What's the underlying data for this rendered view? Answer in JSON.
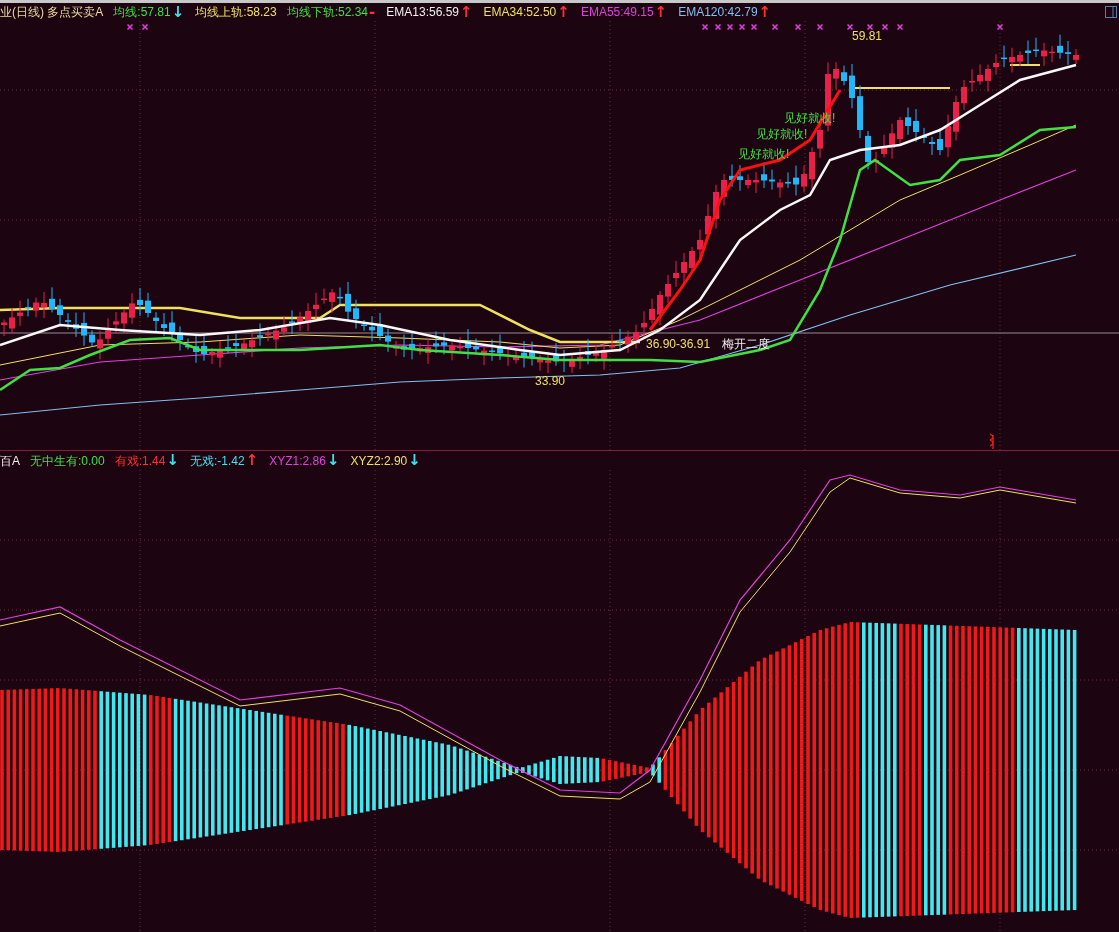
{
  "upper_pane": {
    "legend": [
      {
        "text": "业(日线) 多点买卖A",
        "color": "#e8dc9c"
      },
      {
        "text": "均线:57.81",
        "color": "#40e040",
        "arrow": {
          "text": "↓",
          "color": "#40e0f0"
        }
      },
      {
        "text": "均线上轨:58.23",
        "color": "#f0e060"
      },
      {
        "text": "均线下轨:52.34",
        "color": "#40e040",
        "arrow": {
          "text": "-",
          "color": "#ff3030"
        }
      },
      {
        "text": "EMA13:56.59",
        "color": "#f0f0f0",
        "arrow": {
          "text": "↑",
          "color": "#ff3030"
        }
      },
      {
        "text": "EMA34:52.50",
        "color": "#f0e060",
        "arrow": {
          "text": "↑",
          "color": "#ff3030"
        }
      },
      {
        "text": "EMA55:49.15",
        "color": "#e040e0",
        "arrow": {
          "text": "↑",
          "color": "#ff3030"
        }
      },
      {
        "text": "EMA120:42.79",
        "color": "#80c0f0",
        "arrow": {
          "text": "↑",
          "color": "#ff3030"
        }
      }
    ],
    "annotations": [
      {
        "text": "59.81",
        "kind": "price"
      },
      {
        "text": "见好就收!",
        "kind": "signal"
      },
      {
        "text": "见好就收!",
        "kind": "signal"
      },
      {
        "text": "见好就收!",
        "kind": "signal"
      },
      {
        "text": "36.90-36.91",
        "kind": "price"
      },
      {
        "text": "梅开二度",
        "kind": "label"
      },
      {
        "text": "33.90",
        "kind": "price"
      }
    ]
  },
  "lower_pane": {
    "legend": [
      {
        "text": "百A",
        "color": "#f0f0f0"
      },
      {
        "text": "无中生有:0.00",
        "color": "#40e040"
      },
      {
        "text": "有戏:1.44",
        "color": "#ff3030",
        "arrow": {
          "text": "↓",
          "color": "#40e0f0"
        }
      },
      {
        "text": "无戏:-1.42",
        "color": "#40e0f0",
        "arrow": {
          "text": "↑",
          "color": "#ff3030"
        }
      },
      {
        "text": "XYZ1:2.86",
        "color": "#e040e0",
        "arrow": {
          "text": "↓",
          "color": "#40e0f0"
        }
      },
      {
        "text": "XYZ2:2.90",
        "color": "#f0e060",
        "arrow": {
          "text": "↓",
          "color": "#40e0f0"
        }
      }
    ]
  }
}
